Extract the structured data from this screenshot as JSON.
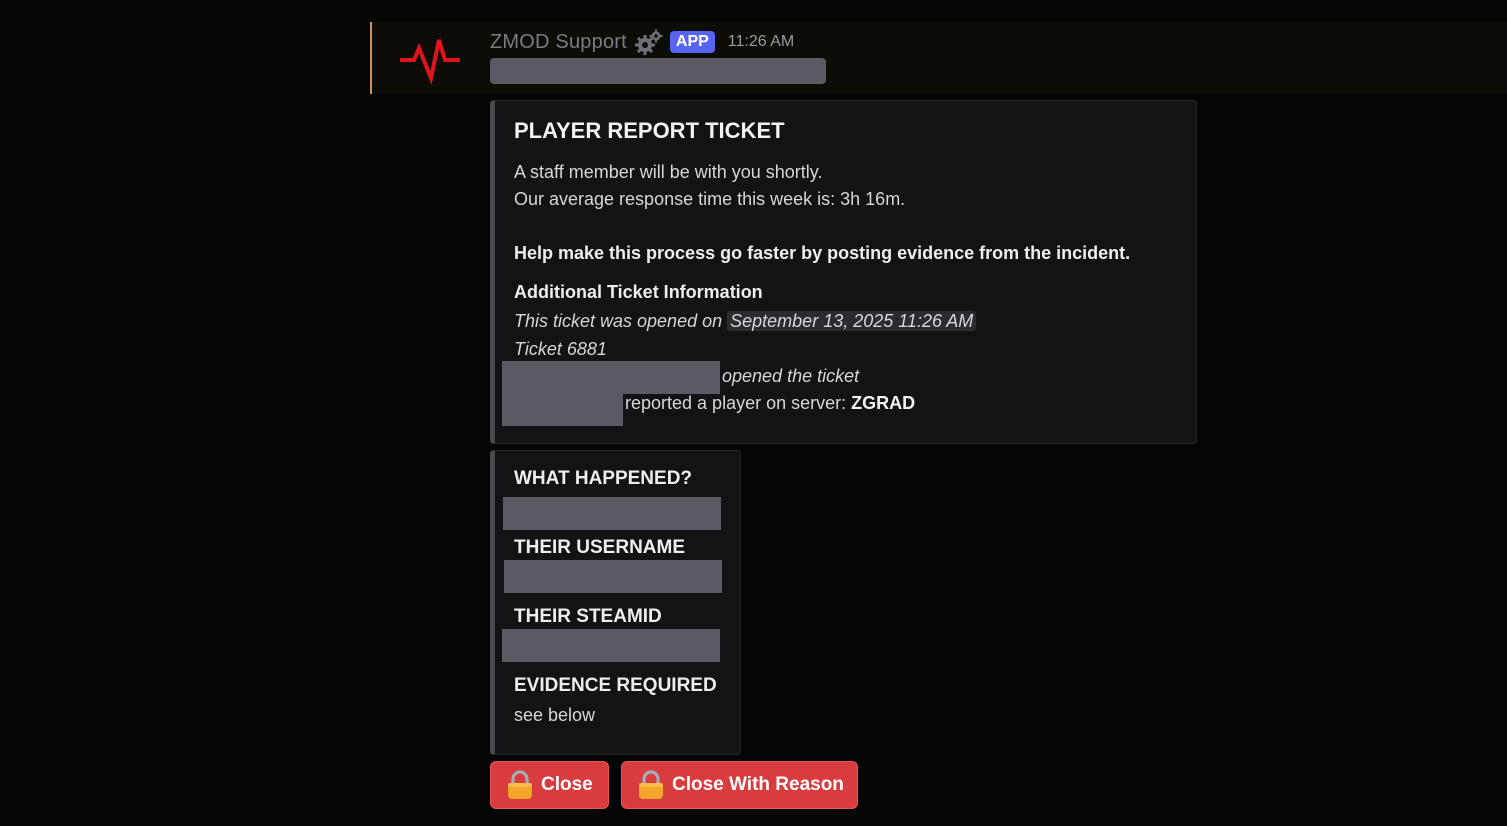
{
  "message": {
    "author": "ZMOD Support",
    "badge": "APP",
    "timestamp": "11:26 AM",
    "author_icon": "gear-icon",
    "avatar_icon": "heartbeat-icon"
  },
  "embed1": {
    "title": "PLAYER REPORT TICKET",
    "line1": "A staff member will be with you shortly.",
    "line2": "Our average response time this week is: 3h 16m.",
    "help": "Help make this process go faster by posting evidence from the incident.",
    "info_heading": "Additional Ticket Information",
    "opened_prefix": "This ticket was opened on",
    "opened_date": "September 13, 2025 11:26 AM",
    "ticket": "Ticket 6881",
    "opened_ticket": "opened the ticket",
    "reported": "reported a player on server:",
    "server": "ZGRAD"
  },
  "embed2": {
    "fields": [
      {
        "name": "WHAT HAPPENED?"
      },
      {
        "name": "THEIR USERNAME"
      },
      {
        "name": "THEIR STEAMID"
      },
      {
        "name": "EVIDENCE REQUIRED",
        "value": "see below"
      }
    ]
  },
  "buttons": {
    "close": "Close",
    "close_with_reason": "Close With Reason",
    "icon": "lock-icon"
  },
  "colors": {
    "button": "#d83c3e",
    "badge": "#5865f2",
    "accent_border": "#c69356",
    "avatar": "#e0141c"
  }
}
